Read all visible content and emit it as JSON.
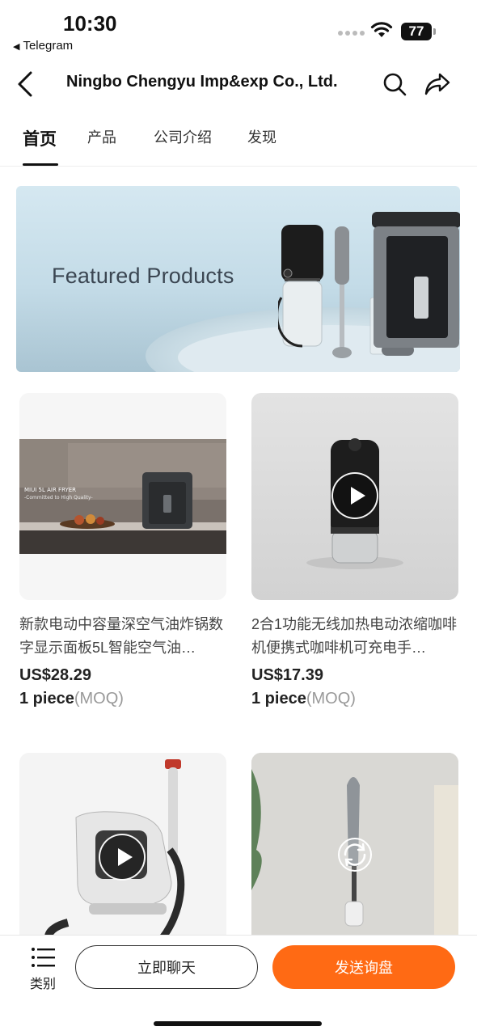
{
  "status_bar": {
    "time": "10:30",
    "back_app": "Telegram",
    "battery": "77"
  },
  "header": {
    "title": "Ningbo Chengyu Imp&exp Co., Ltd.",
    "icons": [
      "back-icon",
      "search-icon",
      "share-icon"
    ]
  },
  "tabs": [
    {
      "label": "首页",
      "active": true
    },
    {
      "label": "产品",
      "active": false
    },
    {
      "label": "公司介绍",
      "active": false
    },
    {
      "label": "发现",
      "active": false
    }
  ],
  "banner": {
    "title": "Featured Products"
  },
  "products": [
    {
      "title": "新款电动中容量深空气油炸锅数字显示面板5L智能空气油…",
      "price": "US$28.29",
      "moq_qty": "1 piece",
      "moq_label": "(MOQ)",
      "image_text_1": "MIUI 5L AIR FRYER",
      "image_text_2": "-Committed to High Quality-"
    },
    {
      "title": "2合1功能无线加热电动浓缩咖啡机便携式咖啡机可充电手…",
      "price": "US$17.39",
      "moq_qty": "1 piece",
      "moq_label": "(MOQ)"
    },
    {
      "title": "",
      "price": "",
      "moq_qty": "",
      "moq_label": ""
    },
    {
      "title": "",
      "price": "",
      "moq_qty": "",
      "moq_label": ""
    }
  ],
  "bottom_bar": {
    "category_label": "类别",
    "chat_label": "立即聊天",
    "inquiry_label": "发送询盘"
  },
  "colors": {
    "accent": "#ff6a14",
    "text_primary": "#222222",
    "text_muted": "#999999"
  }
}
